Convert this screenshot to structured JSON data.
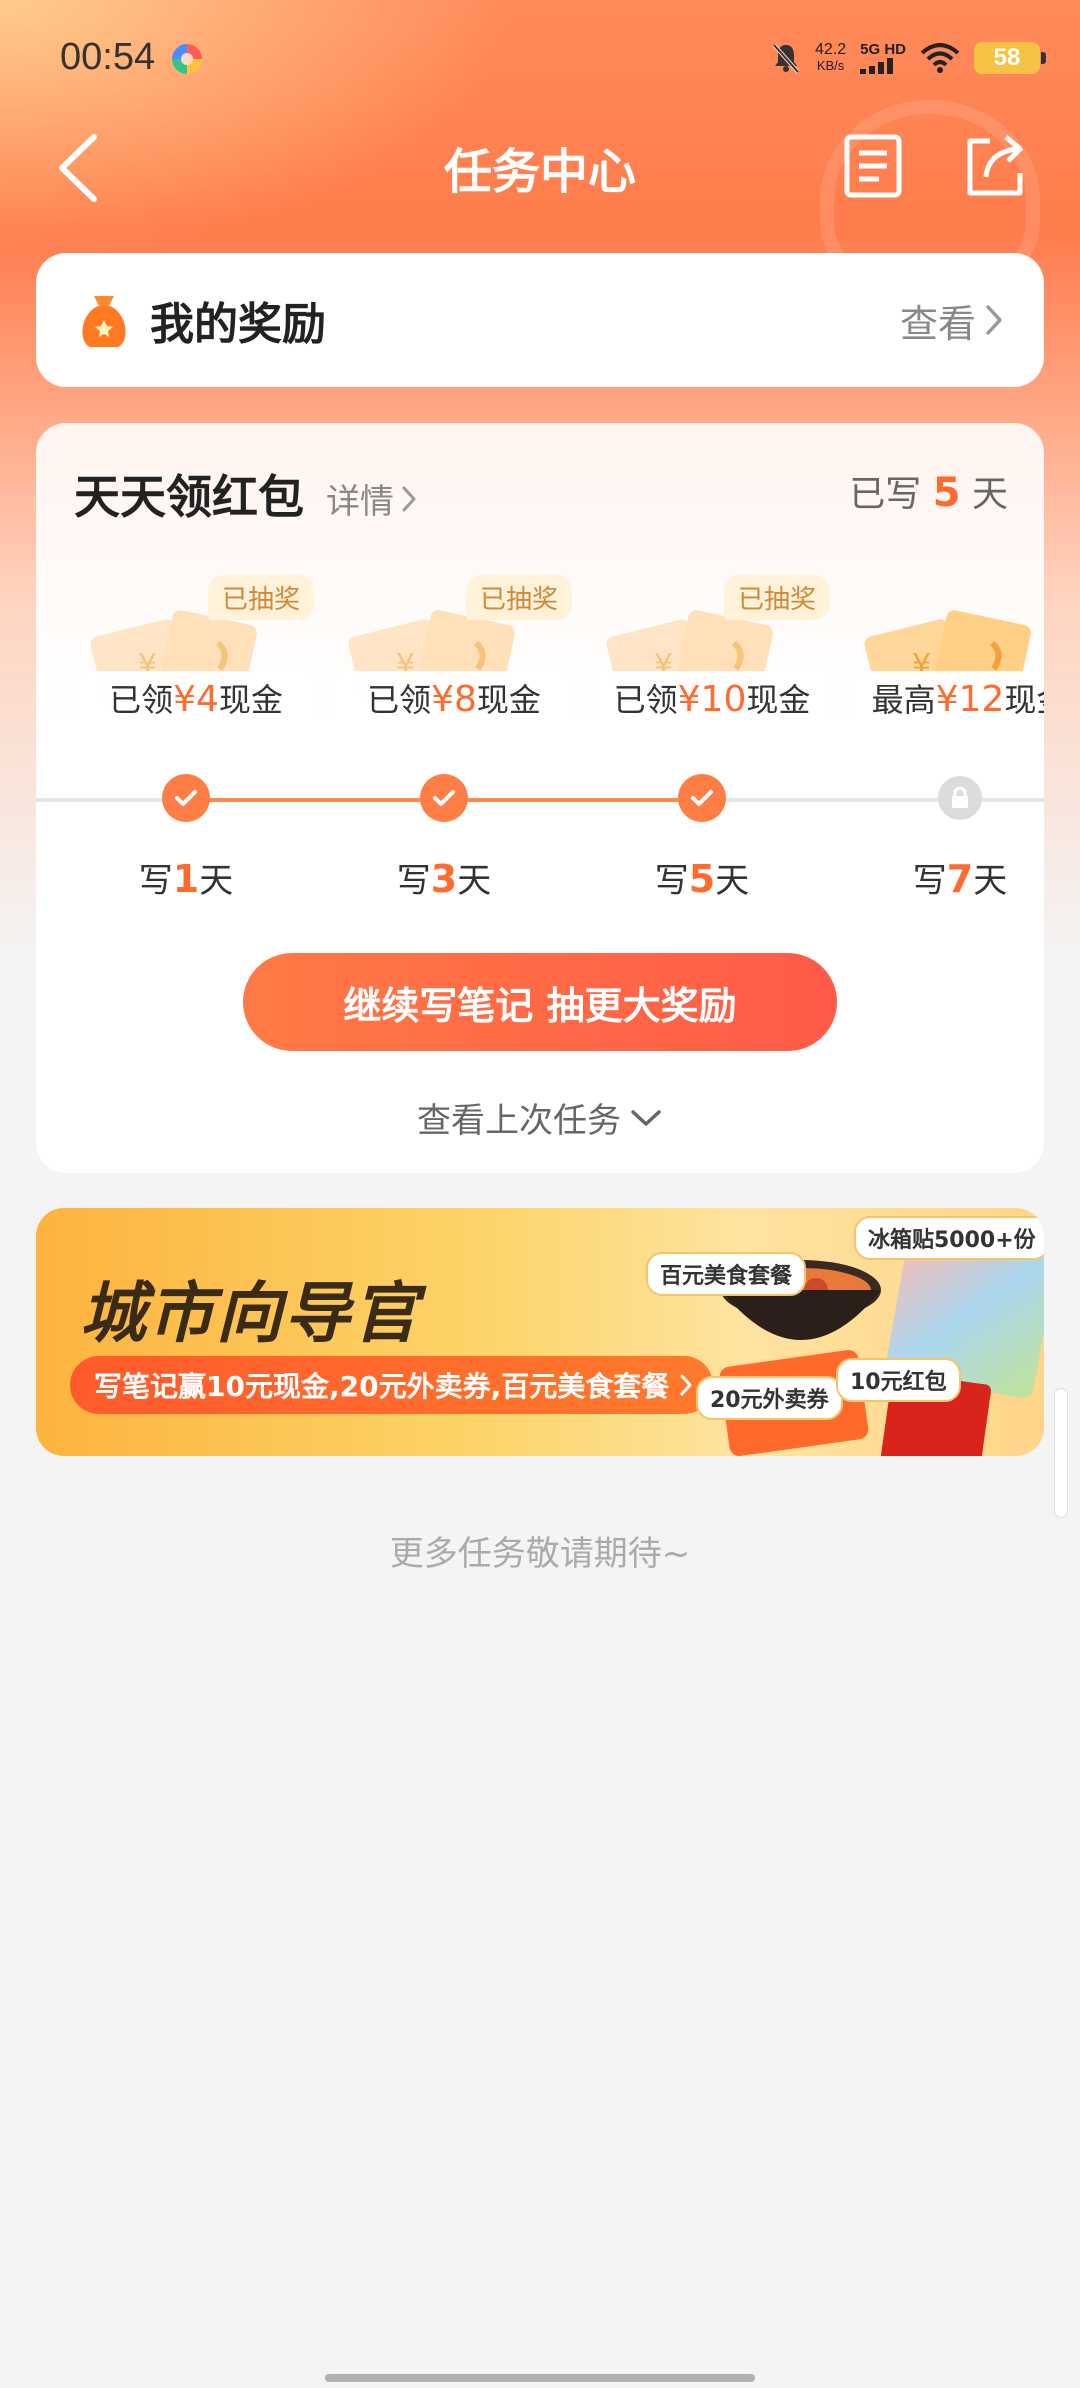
{
  "status": {
    "time": "00:54",
    "netspeed_value": "42.2",
    "netspeed_unit": "KB/s",
    "signal_label": "5G HD",
    "battery": "58"
  },
  "nav": {
    "title": "任务中心"
  },
  "reward": {
    "title": "我的奖励",
    "view": "查看"
  },
  "redpack": {
    "title": "天天领红包",
    "detail": "详情",
    "days_prefix": "已写",
    "days_value": "5",
    "days_suffix": "天",
    "prizes": [
      {
        "badge": "已抽奖",
        "prefix": "已领",
        "amount": "¥4",
        "suffix": "现金"
      },
      {
        "badge": "已抽奖",
        "prefix": "已领",
        "amount": "¥8",
        "suffix": "现金"
      },
      {
        "badge": "已抽奖",
        "prefix": "已领",
        "amount": "¥10",
        "suffix": "现金"
      },
      {
        "badge": "",
        "prefix": "最高",
        "amount": "¥12",
        "suffix": "现金"
      }
    ],
    "milestones": [
      {
        "prefix": "写",
        "n": "1",
        "suffix": "天",
        "state": "done"
      },
      {
        "prefix": "写",
        "n": "3",
        "suffix": "天",
        "state": "done"
      },
      {
        "prefix": "写",
        "n": "5",
        "suffix": "天",
        "state": "done"
      },
      {
        "prefix": "写",
        "n": "7",
        "suffix": "天",
        "state": "locked"
      }
    ],
    "cta": "继续写笔记 抽更大奖励",
    "last_task": "查看上次任务"
  },
  "banner": {
    "title": "城市向导官",
    "subtitle": "写笔记赢10元现金,20元外卖券,百元美食套餐",
    "tags": {
      "meal": "百元美食套餐",
      "sticker": "冰箱贴5000+份",
      "coupon": "20元外卖券",
      "redpacket": "10元红包"
    }
  },
  "footer_note": "更多任务敬请期待~",
  "colors": {
    "accent": "#ff6a2e",
    "header_gradient": "#ff7c4c",
    "cta_start": "#ff7a45",
    "cta_end": "#ff5a48"
  }
}
